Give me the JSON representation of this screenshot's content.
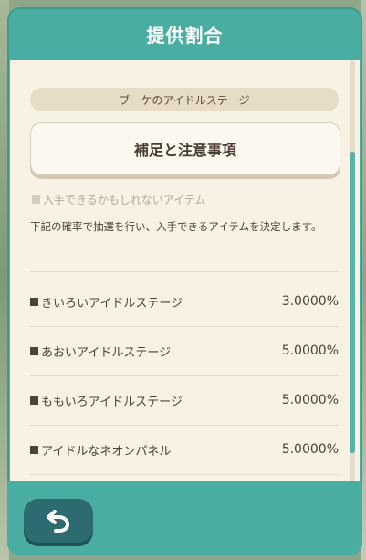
{
  "header": {
    "title": "提供割合"
  },
  "stage": {
    "label": "ブーケのアイドルステージ"
  },
  "notes_button": {
    "label": "補足と注意事項"
  },
  "section": {
    "label": "入手できるかもしれないアイテム"
  },
  "description": "下記の確率で抽選を行い、入手できるアイテムを決定します。",
  "items": [
    {
      "name": "きいろいアイドルステージ",
      "rate": "3.0000%"
    },
    {
      "name": "あおいアイドルステージ",
      "rate": "5.0000%"
    },
    {
      "name": "ももいろアイドルステージ",
      "rate": "5.0000%"
    },
    {
      "name": "アイドルなネオンパネル",
      "rate": "5.0000%"
    }
  ],
  "icons": {
    "back": "back-arrow-icon"
  },
  "colors": {
    "teal": "#4aada2",
    "cream": "#f7f2e4",
    "back_button": "#2c6b70"
  }
}
